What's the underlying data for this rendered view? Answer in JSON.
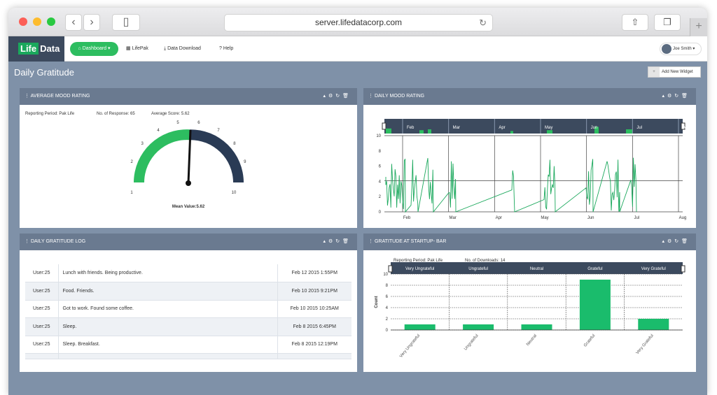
{
  "browser": {
    "url": "server.lifedatacorp.com"
  },
  "app": {
    "logo_part1": "Life",
    "logo_part2": "Data",
    "nav": {
      "dashboard": "Dashboard",
      "lifepak": "LifePak",
      "download": "Data Download",
      "help": "Help"
    },
    "user": "Joe Smith",
    "page_title": "Daily Gratitude",
    "add_widget": "Add New Widget"
  },
  "widgets": {
    "avg_mood": {
      "title": "AVERAGE MOOD RATING",
      "reporting_period": "Reporting Period: Pak Life",
      "responses": "No. of Response: 65",
      "average": "Average Score: 5.62",
      "gauge_labels": [
        "1",
        "2",
        "3",
        "4",
        "5",
        "6",
        "7",
        "8",
        "9",
        "10"
      ],
      "gauge_min": "1",
      "gauge_max": "10",
      "gauge_outer_max": "10",
      "mean_value": "Mean Value:5.62"
    },
    "daily_mood": {
      "title": "DAILY MOOD RATING"
    },
    "log": {
      "title": "DAILY GRATITUDE LOG",
      "rows": [
        {
          "user": "User:25",
          "text": "Lunch with friends. Being productive.",
          "date": "Feb 12 2015 1:55PM"
        },
        {
          "user": "User:25",
          "text": "Food. Friends.",
          "date": "Feb 10 2015 9:21PM"
        },
        {
          "user": "User:25",
          "text": "Got to work. Found some coffee.",
          "date": "Feb 10 2015 10:25AM"
        },
        {
          "user": "User:25",
          "text": "Sleep.",
          "date": "Feb 8 2015 6:45PM"
        },
        {
          "user": "User:25",
          "text": "Sleep. Breakfast.",
          "date": "Feb 8 2015 12:19PM"
        }
      ]
    },
    "bar": {
      "title": "GRATITUDE AT STARTUP- BAR",
      "reporting_period": "Reporting Period: Pak Life",
      "downloads": "No. of Downloads: 14"
    }
  },
  "chart_data": [
    {
      "type": "line",
      "x_ticks": [
        "Feb",
        "Mar",
        "Apr",
        "May",
        "Jun",
        "Jul",
        "Aug"
      ],
      "y_ticks": [
        0,
        2,
        4,
        6,
        8,
        10
      ],
      "ylim": [
        0,
        10
      ],
      "color": "#1aa85c"
    },
    {
      "type": "bar",
      "categories": [
        "Very Ungrateful",
        "Ungrateful",
        "Neutral",
        "Grateful",
        "Very Grateful"
      ],
      "values": [
        1,
        1,
        1,
        9,
        2
      ],
      "ylabel": "Count",
      "ylim": [
        0,
        10
      ],
      "y_ticks": [
        0,
        2,
        4,
        6,
        8,
        10
      ],
      "color": "#1abc6c"
    }
  ]
}
